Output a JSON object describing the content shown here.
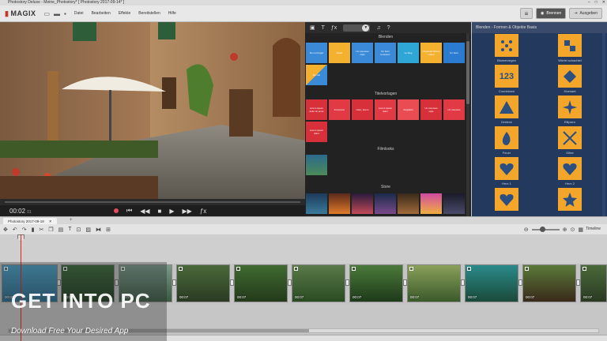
{
  "window": {
    "title": "Photostory Deluxe - Meine_Photostory* [ Photostory 2017-09-14* ]"
  },
  "menubar": {
    "brand": "MAGIX",
    "items": [
      "Datei",
      "Bearbeiten",
      "Effekte",
      "Bereitstellen",
      "Hilfe"
    ],
    "burn_label": "Brennen",
    "export_label": "Ausgeben"
  },
  "transport": {
    "timecode": "00:02",
    "timecode_frames": "01"
  },
  "media_pool": {
    "section_blend": "Blenden",
    "section_title": "Titelvorlagen",
    "section_film": "Filmlooks",
    "section_store": "Store",
    "blend_tiles": [
      "Do not forget",
      "Fader",
      "Un nouveau style",
      "Un futur lumineux",
      "Le blog",
      "Ungewöhnliches Leben",
      "Un futur",
      "Du ciel"
    ],
    "title_tiles": [
      "Lorem ipsum dolor sit amet",
      "Incorporer",
      "Liber, lorem",
      "Lorem ipsum dolor",
      "Vorgaben",
      "Un nouveau style",
      "Un nouveau",
      "Lorem ipsum dolor"
    ]
  },
  "effects_panel": {
    "header": "Blenden - Formen & Objekte Basis",
    "items": [
      {
        "label": "Blumenregen"
      },
      {
        "label": "Würfel schachtel"
      },
      {
        "label": "Countdown",
        "glyph": "123"
      },
      {
        "label": "Diamant"
      },
      {
        "label": "Dreieck"
      },
      {
        "label": "Ellipsen"
      },
      {
        "label": "Feuer"
      },
      {
        "label": "Gitter"
      },
      {
        "label": "Herz 1"
      },
      {
        "label": "Herz 2"
      },
      {
        "label": "",
        "icon": "heart-icon"
      },
      {
        "label": "",
        "icon": "star-icon"
      }
    ]
  },
  "timeline": {
    "tab_label": "Photostory 2017-09-18",
    "mode_label": "Timeline",
    "clips": [
      {
        "duration": "00:02"
      },
      {
        "duration": "00:07"
      },
      {
        "duration": "00:07"
      },
      {
        "duration": "00:07"
      },
      {
        "duration": "00:07"
      },
      {
        "duration": "00:07"
      },
      {
        "duration": "00:07"
      },
      {
        "duration": "00:07"
      },
      {
        "duration": "00:07"
      },
      {
        "duration": "00:07"
      },
      {
        "duration": "00:07"
      }
    ]
  },
  "watermark": {
    "title": "GET INTO PC",
    "subtitle": "Download Free Your Desired App"
  },
  "colors": {
    "accent_orange": "#f4a62a",
    "effects_bg": "#233a5e",
    "playhead": "#e02222",
    "record": "#e84a5f"
  }
}
